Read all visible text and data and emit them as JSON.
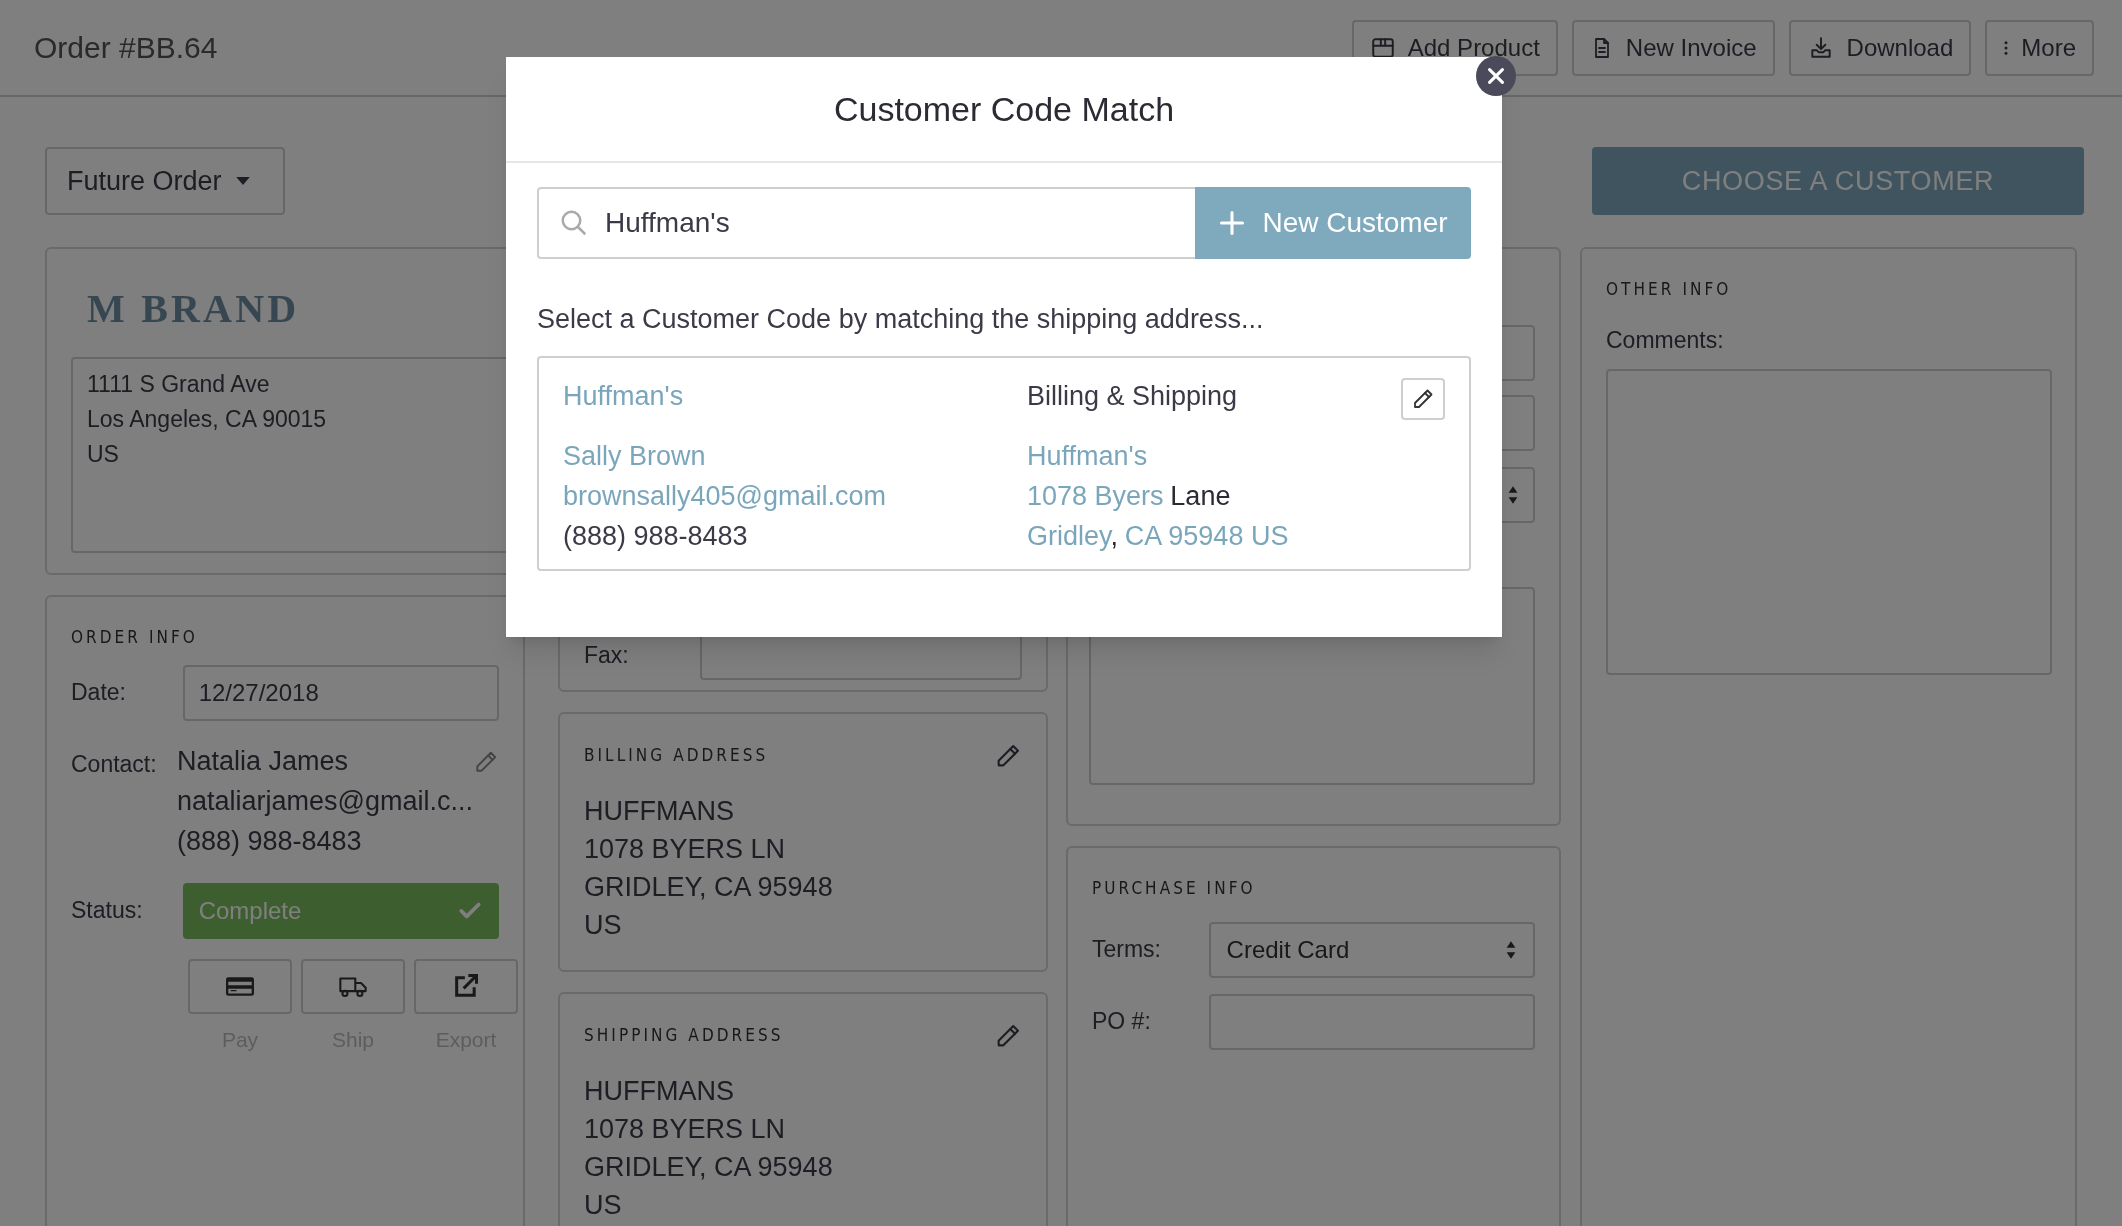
{
  "header": {
    "title": "Order #BB.64",
    "actions": [
      {
        "label": "Add Product",
        "kind": "box"
      },
      {
        "label": "New Invoice",
        "kind": "document"
      },
      {
        "label": "Download",
        "kind": "download"
      },
      {
        "label": "More",
        "kind": "more"
      }
    ]
  },
  "order_type": {
    "value": "Future Order"
  },
  "choose_customer": "CHOOSE A CUSTOMER",
  "brand": {
    "logo": "M BRAND",
    "address": [
      "1111 S Grand Ave",
      "Los Angeles, CA 90015",
      "US"
    ]
  },
  "order_info": {
    "heading": "ORDER INFO",
    "date_label": "Date:",
    "date": "12/27/2018",
    "contact_label": "Contact:",
    "contact": [
      "Natalia James",
      "nataliarjames@gmail.c...",
      "(888) 988-8483"
    ],
    "status_label": "Status:",
    "status": "Complete",
    "actions": [
      {
        "label": "Pay",
        "kind": "card"
      },
      {
        "label": "Ship",
        "kind": "truck"
      },
      {
        "label": "Export",
        "kind": "export"
      }
    ]
  },
  "contact_card": {
    "fax_label": "Fax:"
  },
  "billing_address": {
    "heading": "BILLING ADDRESS",
    "lines": [
      "HUFFMANS",
      "1078 BYERS LN",
      "GRIDLEY, CA 95948",
      "US"
    ]
  },
  "shipping_address": {
    "heading": "SHIPPING ADDRESS",
    "lines": [
      "HUFFMANS",
      "1078 BYERS LN",
      "GRIDLEY, CA 95948",
      "US"
    ]
  },
  "purchase_info": {
    "heading": "PURCHASE INFO",
    "terms_label": "Terms:",
    "terms": "Credit Card",
    "po_label": "PO #:"
  },
  "other_info": {
    "heading": "OTHER INFO",
    "comments_label": "Comments:"
  },
  "modal": {
    "title": "Customer Code Match",
    "search": {
      "value": "Huffman's"
    },
    "new_button": "New Customer",
    "instruction": "Select a Customer Code by matching the shipping address...",
    "match": {
      "name": "Huffman's",
      "contact_name": "Sally Brown",
      "email": "brownsally405@gmail.com",
      "phone": "(888) 988-8483",
      "address_type": "Billing & Shipping",
      "address_lines": [
        [
          {
            "text": "Huffman's",
            "matched": true
          }
        ],
        [
          {
            "text": "1078 Byers",
            "matched": true
          },
          {
            "text": "Lane",
            "matched": false
          }
        ],
        [
          {
            "text": "Gridley",
            "matched": true
          },
          {
            "text": ",",
            "matched": false,
            "attached": true
          },
          {
            "text": "CA 95948 US",
            "matched": true
          }
        ]
      ]
    }
  }
}
